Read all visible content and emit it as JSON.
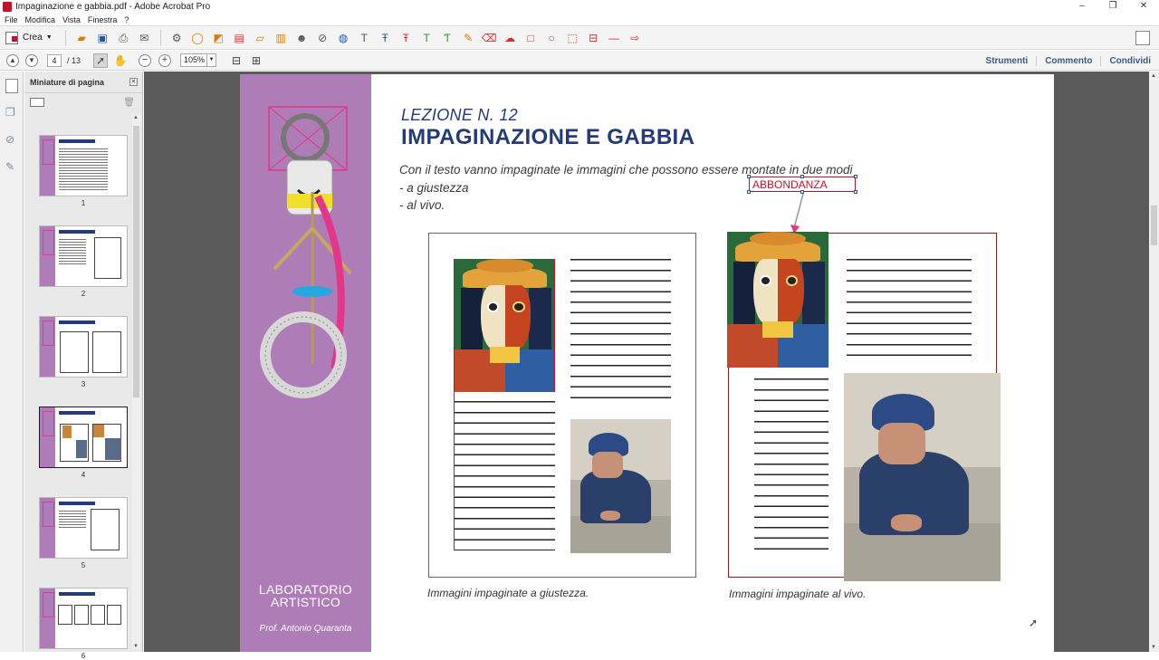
{
  "window": {
    "title": "Impaginazione e gabbia.pdf - Adobe Acrobat Pro",
    "controls": [
      "–",
      "❐",
      "✕"
    ]
  },
  "menu": [
    "File",
    "Modifica",
    "Vista",
    "Finestra",
    "?"
  ],
  "toolbar": {
    "create_label": "Crea"
  },
  "navigation": {
    "current_page": "4",
    "total_pages": "/ 13",
    "zoom": "105%"
  },
  "right_panel_links": [
    "Strumenti",
    "Commento",
    "Condividi"
  ],
  "thumbnails_panel": {
    "title": "Miniature di pagina",
    "pages": [
      "1",
      "2",
      "3",
      "4",
      "5",
      "6"
    ],
    "selected": "4"
  },
  "document": {
    "lesson": "LEZIONE N. 12",
    "title": "IMPAGINAZIONE E GABBIA",
    "paragraph": [
      "Con il testo vanno impaginate le immagini che possono essere montate in due modi",
      "- a giustezza",
      "- al vivo."
    ],
    "annotation": "ABBONDANZA",
    "caption_left": "Immagini impaginate a giustezza.",
    "caption_right": "Immagini impaginate al vivo.",
    "side_title": "LABORATORIO ARTISTICO",
    "side_author": "Prof. Antonio Quaranta"
  },
  "colors": {
    "band": "#ae7db7",
    "title_blue": "#233b78",
    "annotation_red": "#c2142a"
  }
}
